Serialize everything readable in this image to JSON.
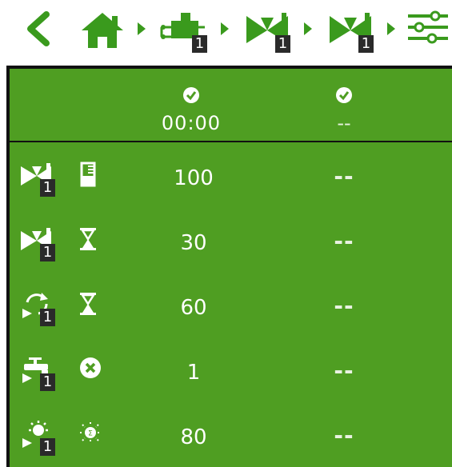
{
  "colors": {
    "accent": "#4f9e22",
    "panel_bg": "#4f9e22",
    "badge_bg": "#2a2a2a",
    "text": "#ffffff"
  },
  "breadcrumb": {
    "items": [
      {
        "name": "back-icon"
      },
      {
        "name": "home-icon"
      },
      {
        "name": "controller-icon",
        "badge": "1"
      },
      {
        "name": "valve-icon",
        "badge": "1"
      },
      {
        "name": "valve-icon",
        "badge": "1"
      },
      {
        "name": "settings-sliders-icon"
      }
    ]
  },
  "header": {
    "col1": {
      "icon": "check-clock-icon",
      "time": "00:00"
    },
    "col2": {
      "icon": "check-clock-icon",
      "time": "--"
    }
  },
  "rows": [
    {
      "icon1": "valve-icon",
      "badge": "1",
      "icon2": "gauge-icon",
      "value": "100",
      "dash": "--"
    },
    {
      "icon1": "valve-icon",
      "badge": "1",
      "icon2": "hourglass-icon",
      "value": "30",
      "dash": "--"
    },
    {
      "icon1": "cycle-play-icon",
      "badge": "1",
      "icon2": "hourglass-icon",
      "value": "60",
      "dash": "--"
    },
    {
      "icon1": "faucet-play-icon",
      "badge": "1",
      "icon2": "cancel-icon",
      "value": "1",
      "dash": "--"
    },
    {
      "icon1": "sun-play-icon",
      "badge": "1",
      "icon2": "sun-sum-icon",
      "value": "80",
      "dash": "--"
    }
  ]
}
